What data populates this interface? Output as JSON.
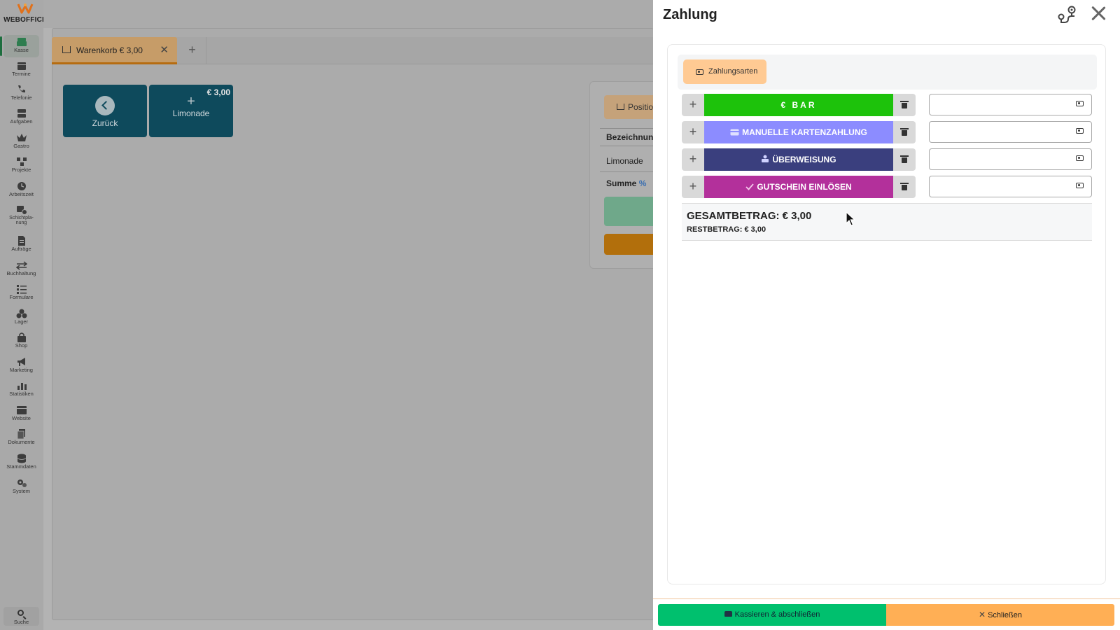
{
  "app": {
    "logo_text": "WEBOFFICE"
  },
  "sidebar": {
    "items": [
      {
        "key": "kasse",
        "label": "Kasse",
        "icon": "register-icon",
        "active": true
      },
      {
        "key": "termine",
        "label": "Termine",
        "icon": "calendar-icon"
      },
      {
        "key": "telefonie",
        "label": "Telefonie",
        "icon": "phone-icon"
      },
      {
        "key": "aufgaben",
        "label": "Aufgaben",
        "icon": "tasks-icon"
      },
      {
        "key": "gastro",
        "label": "Gastro",
        "icon": "crown-icon"
      },
      {
        "key": "projekte",
        "label": "Projekte",
        "icon": "project-icon"
      },
      {
        "key": "arbeitszeit",
        "label": "Arbeitszeit",
        "icon": "clock-icon"
      },
      {
        "key": "schichtplanung",
        "label": "Schichtpla-\nnung",
        "icon": "calendar-clock-icon"
      },
      {
        "key": "auftraege",
        "label": "Aufträge",
        "icon": "document-icon"
      },
      {
        "key": "buchhaltung",
        "label": "Buchhaltung",
        "icon": "arrows-icon"
      },
      {
        "key": "formulare",
        "label": "Formulare",
        "icon": "list-icon"
      },
      {
        "key": "lager",
        "label": "Lager",
        "icon": "boxes-icon"
      },
      {
        "key": "shop",
        "label": "Shop",
        "icon": "bag-icon"
      },
      {
        "key": "marketing",
        "label": "Marketing",
        "icon": "megaphone-icon"
      },
      {
        "key": "statistiken",
        "label": "Statistiken",
        "icon": "chart-icon"
      },
      {
        "key": "website",
        "label": "Website",
        "icon": "browser-icon"
      },
      {
        "key": "dokumente",
        "label": "Dokumente",
        "icon": "files-icon"
      },
      {
        "key": "stammdaten",
        "label": "Stammdaten",
        "icon": "database-icon"
      },
      {
        "key": "system",
        "label": "System",
        "icon": "gears-icon"
      }
    ],
    "search_label": "Suche"
  },
  "main": {
    "tab_label": "Warenkorb € 3,00",
    "tiles": {
      "back_label": "Zurück",
      "product_label": "Limonade",
      "product_price": "€ 3,00"
    },
    "cart_card": {
      "position_label": "Positio",
      "col_header": "Bezeichnung",
      "row_item": "Limonade",
      "sum_label": "Summe"
    }
  },
  "payment": {
    "title": "Zahlung",
    "tab_label": "Zahlungsarten",
    "methods": [
      {
        "label": "€ BAR",
        "color": "#1dc20b",
        "value": ""
      },
      {
        "label": "MANUELLE KARTENZAHLUNG",
        "color": "#8c8cff",
        "value": ""
      },
      {
        "label": "ÜBERWEISUNG",
        "color": "#3a3f7e",
        "value": ""
      },
      {
        "label": "GUTSCHEIN EINLÖSEN",
        "color": "#b3309b",
        "value": ""
      }
    ],
    "total_label": "GESAMTBETRAG: € 3,00",
    "rest_label": "RESTBETRAG: € 3,00",
    "footer": {
      "cashout_label": "Kassieren & abschließen",
      "close_label": "Schließen"
    }
  },
  "colors": {
    "accent_orange": "#ffaf55",
    "accent_green": "#00c06e",
    "tile_blue": "#0e4a5c"
  }
}
